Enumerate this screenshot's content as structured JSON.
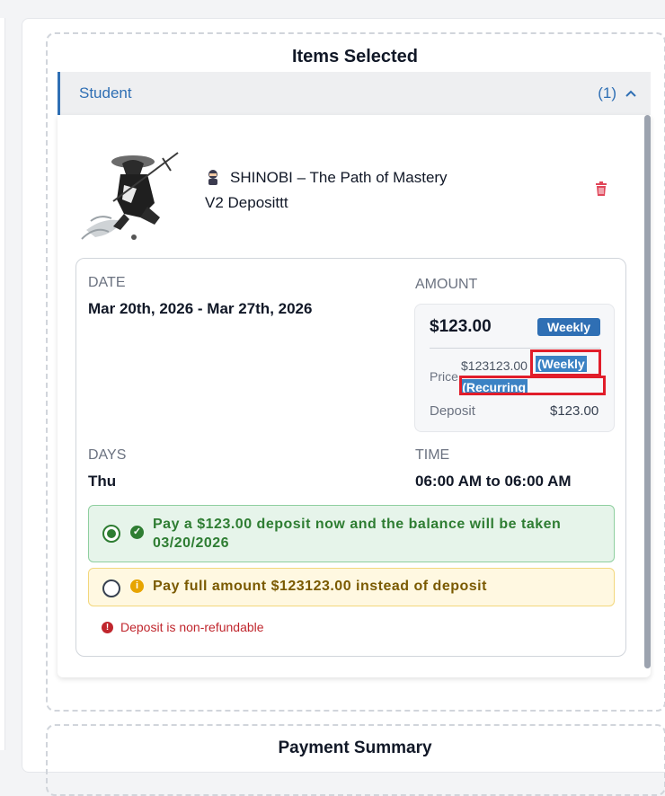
{
  "items_section": {
    "title": "Items Selected",
    "group_label": "Student",
    "group_count": "(1)"
  },
  "product": {
    "name_line1": "SHINOBI – The Path of Mastery",
    "name_line2": "V2 Deposittt",
    "emoji_icon": "ninja-icon"
  },
  "details": {
    "date_label": "DATE",
    "date_value": "Mar 20th, 2026 - Mar 27th, 2026",
    "amount_label": "AMOUNT",
    "days_label": "DAYS",
    "days_value": "Thu",
    "time_label": "TIME",
    "time_value": "06:00 AM to 06:00 AM"
  },
  "amount_card": {
    "amount": "$123.00",
    "badge": "Weekly",
    "price_label": "Price",
    "price_value": "$123123.00",
    "recurring_part1": "(Weekly",
    "recurring_part2": "Recurring)",
    "deposit_label": "Deposit",
    "deposit_value": "$123.00"
  },
  "payment_options": {
    "deposit_option": "Pay a $123.00 deposit now and the balance will be taken 03/20/2026",
    "full_option": "Pay full amount $123123.00 instead of deposit",
    "selected": "deposit"
  },
  "notice": {
    "text": "Deposit is non-refundable"
  },
  "payment_summary": {
    "title": "Payment Summary"
  },
  "colors": {
    "accent": "#2f6fb4",
    "success": "#2e7d32",
    "warning": "#e7a400",
    "danger": "#c0262d",
    "highlight_box": "#e11d2a"
  }
}
